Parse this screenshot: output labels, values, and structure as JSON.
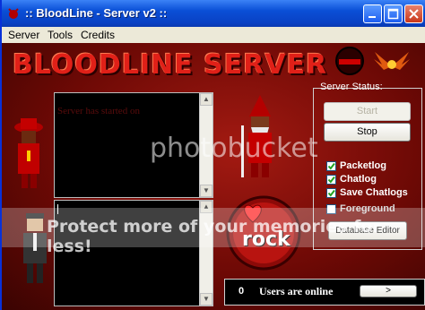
{
  "window": {
    "title": ":: BloodLine - Server v2 ::"
  },
  "menu": {
    "server": "Server",
    "tools": "Tools",
    "credits": "Credits"
  },
  "banner": {
    "title": "BLOODLINE SERVER"
  },
  "log": {
    "text": "Server has started on"
  },
  "status": {
    "label": "Server Status:",
    "start_label": "Start",
    "stop_label": "Stop",
    "packetlog": "Packetlog",
    "chatlog": "Chatlog",
    "save_chatlogs": "Save Chatlogs",
    "foreground": "Foreground",
    "database_editor": "Database Editor"
  },
  "users": {
    "count": "0",
    "label": "Users are online",
    "go": ">"
  },
  "badge": {
    "text": "rock"
  },
  "watermark": {
    "logo": "photobucket",
    "tagline": "Protect more of your memories for less!"
  },
  "colors": {
    "title_blue": "#0a4fd6",
    "accent_red": "#e02018"
  }
}
